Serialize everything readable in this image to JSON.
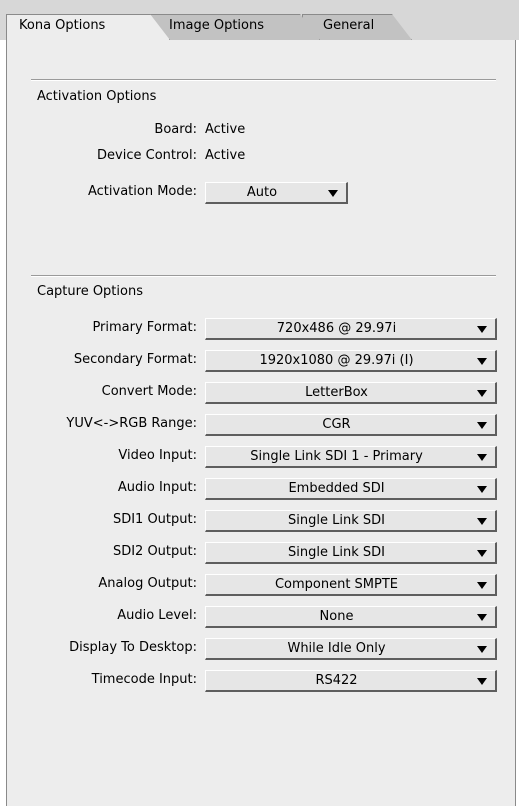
{
  "tabs": [
    {
      "label": "Kona Options",
      "active": true
    },
    {
      "label": "Image Options",
      "active": false
    },
    {
      "label": "General",
      "active": false
    }
  ],
  "activation": {
    "title": "Activation Options",
    "board_label": "Board:",
    "board_value": "Active",
    "device_control_label": "Device Control:",
    "device_control_value": "Active",
    "mode_label": "Activation Mode:",
    "mode_value": "Auto"
  },
  "capture": {
    "title": "Capture Options",
    "rows": [
      {
        "label": "Primary Format:",
        "value": "720x486 @ 29.97i"
      },
      {
        "label": "Secondary Format:",
        "value": "1920x1080 @ 29.97i (I)"
      },
      {
        "label": "Convert Mode:",
        "value": "LetterBox"
      },
      {
        "label": "YUV<->RGB Range:",
        "value": "CGR"
      },
      {
        "label": "Video Input:",
        "value": "Single Link SDI 1 - Primary"
      },
      {
        "label": "Audio Input:",
        "value": "Embedded SDI"
      },
      {
        "label": "SDI1 Output:",
        "value": "Single Link SDI"
      },
      {
        "label": "SDI2 Output:",
        "value": "Single Link SDI"
      },
      {
        "label": "Analog Output:",
        "value": "Component SMPTE"
      },
      {
        "label": "Audio Level:",
        "value": "None"
      },
      {
        "label": "Display To Desktop:",
        "value": "While Idle Only"
      },
      {
        "label": "Timecode Input:",
        "value": "RS422"
      }
    ]
  }
}
